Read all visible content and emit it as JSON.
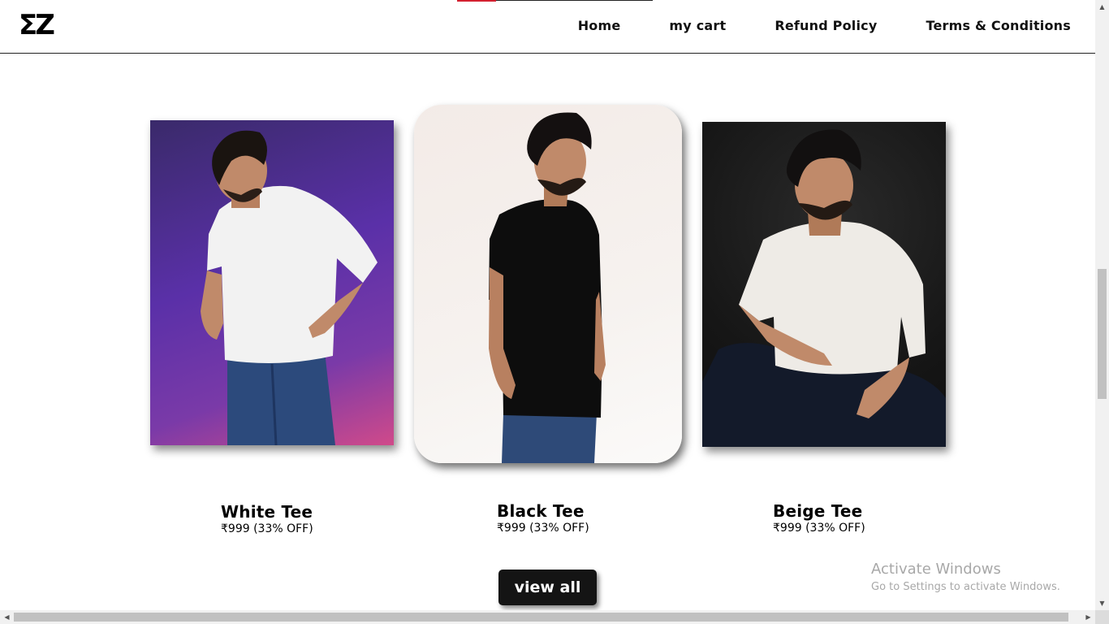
{
  "header": {
    "logo": "ΣZ",
    "nav": [
      "Home",
      "my cart",
      "Refund Policy",
      "Terms & Conditions"
    ],
    "scroll_progress": 0.2
  },
  "products": [
    {
      "name": "White Tee",
      "price": "₹999 (33% OFF)"
    },
    {
      "name": "Black Tee",
      "price": "₹999 (33% OFF)"
    },
    {
      "name": "Beige Tee",
      "price": "₹999 (33% OFF)"
    }
  ],
  "view_all_label": "view all",
  "watermark": {
    "title": "Activate Windows",
    "subtitle": "Go to Settings to activate Windows."
  },
  "colors": {
    "accent": "#d42030",
    "button_bg": "#141414"
  },
  "icons": {
    "scroll_up": "▲",
    "scroll_down": "▼",
    "scroll_left": "◀",
    "scroll_right": "▶"
  }
}
